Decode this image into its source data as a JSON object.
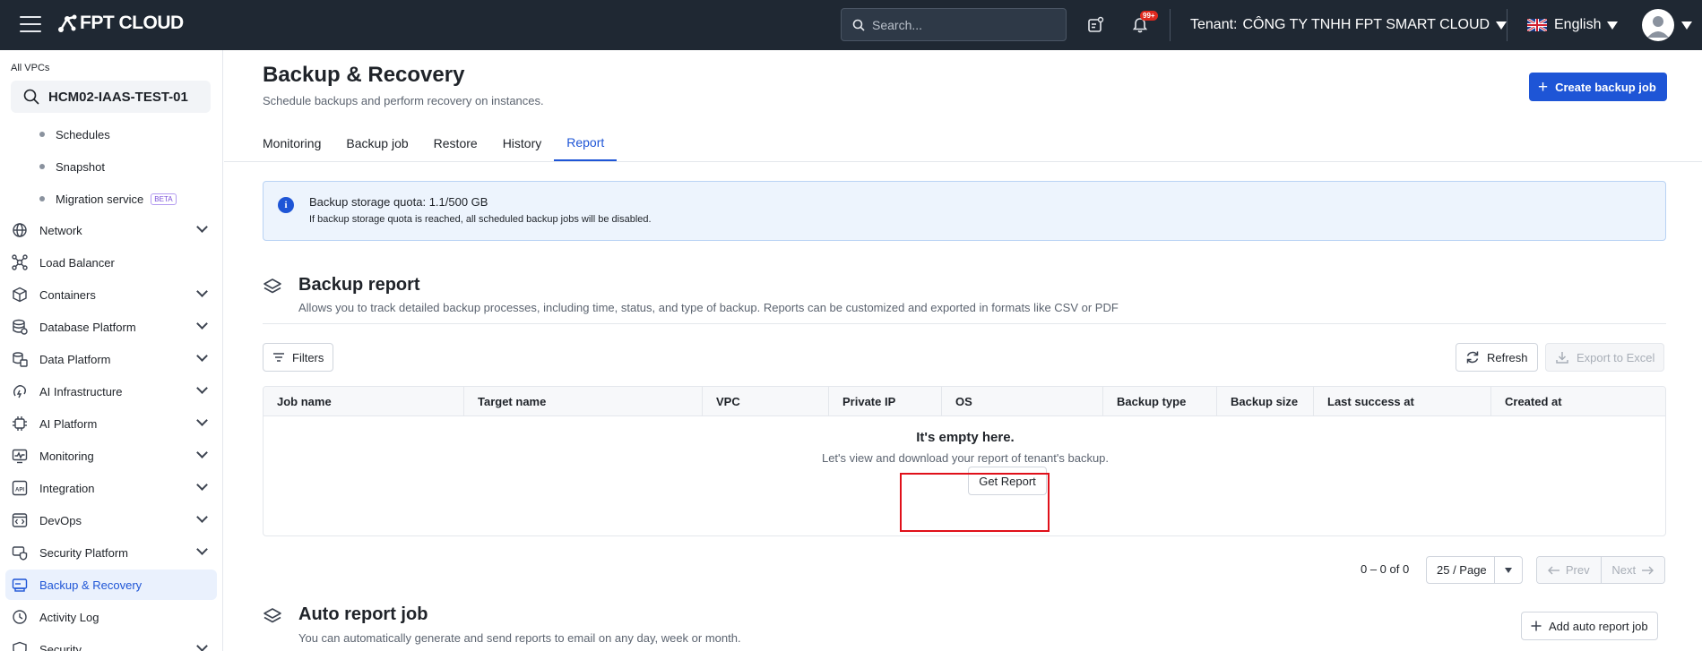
{
  "topbar": {
    "brand": "FPT CLOUD",
    "search_placeholder": "Search...",
    "notification_badge": "99+",
    "tenant_label": "Tenant:",
    "tenant_name": "CÔNG TY TNHH FPT SMART CLOUD",
    "language": "English"
  },
  "sidebar": {
    "vpc_label": "All VPCs",
    "vpc_selected": "HCM02-IAAS-TEST-01",
    "subitems": [
      "Schedules",
      "Snapshot",
      "Migration service"
    ],
    "beta_badge": "BETA",
    "items": [
      {
        "label": "Network",
        "icon": "globe-icon"
      },
      {
        "label": "Load Balancer",
        "icon": "load-balancer-icon"
      },
      {
        "label": "Containers",
        "icon": "cube-icon"
      },
      {
        "label": "Database Platform",
        "icon": "database-icon"
      },
      {
        "label": "Data Platform",
        "icon": "data-platform-icon"
      },
      {
        "label": "AI Infrastructure",
        "icon": "ai-infrastructure-icon"
      },
      {
        "label": "AI Platform",
        "icon": "ai-chip-icon"
      },
      {
        "label": "Monitoring",
        "icon": "monitoring-icon"
      },
      {
        "label": "Integration",
        "icon": "api-icon"
      },
      {
        "label": "DevOps",
        "icon": "code-window-icon"
      },
      {
        "label": "Security Platform",
        "icon": "security-icon"
      },
      {
        "label": "Backup & Recovery",
        "icon": "backup-icon"
      },
      {
        "label": "Activity Log",
        "icon": "clock-icon"
      },
      {
        "label": "Security",
        "icon": "shield-icon"
      }
    ]
  },
  "page": {
    "title": "Backup & Recovery",
    "subtitle": "Schedule backups and perform recovery on instances.",
    "create_button": "Create backup job",
    "tabs": [
      "Monitoring",
      "Backup job",
      "Restore",
      "History",
      "Report"
    ],
    "active_tab": "Report"
  },
  "info": {
    "title": "Backup storage quota: 1.1/500 GB",
    "description": "If backup storage quota is reached, all scheduled backup jobs will be disabled."
  },
  "report": {
    "title": "Backup report",
    "description": "Allows you to track detailed backup processes, including time, status, and type of backup. Reports can be customized and exported in formats like CSV or PDF",
    "filters": "Filters",
    "refresh": "Refresh",
    "export": "Export to Excel",
    "columns": [
      "Job name",
      "Target name",
      "VPC",
      "Private IP",
      "OS",
      "Backup type",
      "Backup size",
      "Last success at",
      "Created at"
    ],
    "empty_title": "It's empty here.",
    "empty_desc": "Let's view and download your report of tenant's backup.",
    "get_report": "Get Report"
  },
  "pagination": {
    "count": "0 – 0 of 0",
    "page_size": "25 / Page",
    "prev": "Prev",
    "next": "Next"
  },
  "auto_report": {
    "title": "Auto report job",
    "description": "You can automatically generate and send reports to email on any day, week or month.",
    "add_button": "Add auto report job"
  },
  "colors": {
    "topbar_bg": "#1f2833",
    "primary": "#1e55d6",
    "highlight": "#e0101a"
  }
}
